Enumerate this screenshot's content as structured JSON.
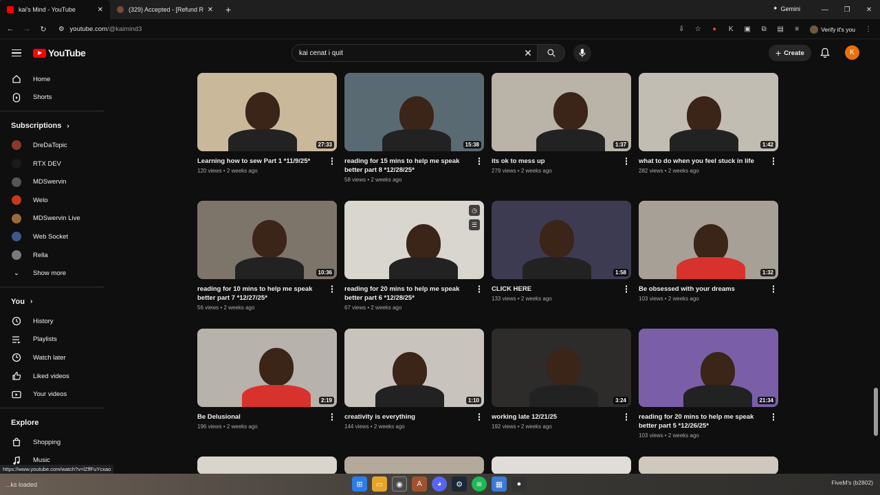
{
  "browser": {
    "tabs": [
      {
        "title": "kai's Mind - YouTube",
        "active": true
      },
      {
        "title": "(329) Accepted - [Refund Reque",
        "active": false
      }
    ],
    "gemini": "Gemini",
    "url_host": "youtube.com",
    "url_path": "/@kaimind3",
    "verify": "Verify it's you"
  },
  "masthead": {
    "logo": "YouTube",
    "search_value": "kai cenat i quit",
    "create": "Create",
    "account_initial": "K"
  },
  "sidebar": {
    "main": [
      {
        "label": "Home",
        "icon": "home-icon"
      },
      {
        "label": "Shorts",
        "icon": "shorts-icon"
      }
    ],
    "subscriptions_heading": "Subscriptions",
    "subscriptions": [
      {
        "label": "DreDaTopic",
        "color": "#8a3a2a"
      },
      {
        "label": "RTX DEV",
        "color": "#1b1b1b"
      },
      {
        "label": "MDSwervin",
        "color": "#555555"
      },
      {
        "label": "Welo",
        "color": "#c43a1c"
      },
      {
        "label": "MDSwervin Live",
        "color": "#9a6b3a"
      },
      {
        "label": "Web Socket",
        "color": "#3b5a8a"
      },
      {
        "label": "Rella",
        "color": "#7a7a7a"
      }
    ],
    "show_more": "Show more",
    "you_heading": "You",
    "you": [
      {
        "label": "History",
        "icon": "history-icon"
      },
      {
        "label": "Playlists",
        "icon": "playlists-icon"
      },
      {
        "label": "Watch later",
        "icon": "watch-later-icon"
      },
      {
        "label": "Liked videos",
        "icon": "like-icon"
      },
      {
        "label": "Your videos",
        "icon": "your-videos-icon"
      }
    ],
    "explore_heading": "Explore",
    "explore": [
      {
        "label": "Shopping",
        "icon": "shopping-icon"
      },
      {
        "label": "Music",
        "icon": "music-icon"
      }
    ]
  },
  "videos": [
    {
      "title": "Learning how to sew Part 1 *11/9/25*",
      "views": "120 views",
      "age": "2 weeks ago",
      "duration": "27:33",
      "bg": "#c9b89a"
    },
    {
      "title": "reading for 15 mins to help me speak better part 8 *12/28/25*",
      "views": "58 views",
      "age": "2 weeks ago",
      "duration": "15:38",
      "bg": "#5a6a73"
    },
    {
      "title": "its ok to mess up",
      "views": "279 views",
      "age": "2 weeks ago",
      "duration": "1:37",
      "bg": "#b9b3a8"
    },
    {
      "title": "what to do when you feel stuck in life",
      "views": "282 views",
      "age": "2 weeks ago",
      "duration": "1:42",
      "bg": "#c2bdb3"
    },
    {
      "title": "reading for 10 mins to help me speak better part 7 *12/27/25*",
      "views": "56 views",
      "age": "2 weeks ago",
      "duration": "10:36",
      "bg": "#7d746a"
    },
    {
      "title": "reading for 20 mins to help me speak better part 6 *12/28/25*",
      "views": "67 views",
      "age": "2 weeks ago",
      "duration": "",
      "bg": "#d9d6d0"
    },
    {
      "title": "CLICK HERE",
      "views": "133 views",
      "age": "2 weeks ago",
      "duration": "1:58",
      "bg": "#3d3b52"
    },
    {
      "title": "Be obsessed with your dreams",
      "views": "103 views",
      "age": "2 weeks ago",
      "duration": "1:32",
      "bg": "#a7a097"
    },
    {
      "title": "Be Delusional",
      "views": "196 views",
      "age": "2 weeks ago",
      "duration": "2:19",
      "bg": "#b7b2ab"
    },
    {
      "title": "creativity is everything",
      "views": "144 views",
      "age": "2 weeks ago",
      "duration": "1:10",
      "bg": "#c8c3bc"
    },
    {
      "title": "working late 12/21/25",
      "views": "192 views",
      "age": "2 weeks ago",
      "duration": "3:24",
      "bg": "#2e2c2b"
    },
    {
      "title": "reading for 20 mins to help me speak better part 5 *12/26/25*",
      "views": "103 views",
      "age": "2 weeks ago",
      "duration": "21:34",
      "bg": "#7a5fa8"
    }
  ],
  "status_url": "https://www.youtube.com/watch?v=lZffFuYcxao",
  "taskbar": {
    "left_text": "...ks loaded",
    "right_text": "FiveM's (b2802)"
  }
}
